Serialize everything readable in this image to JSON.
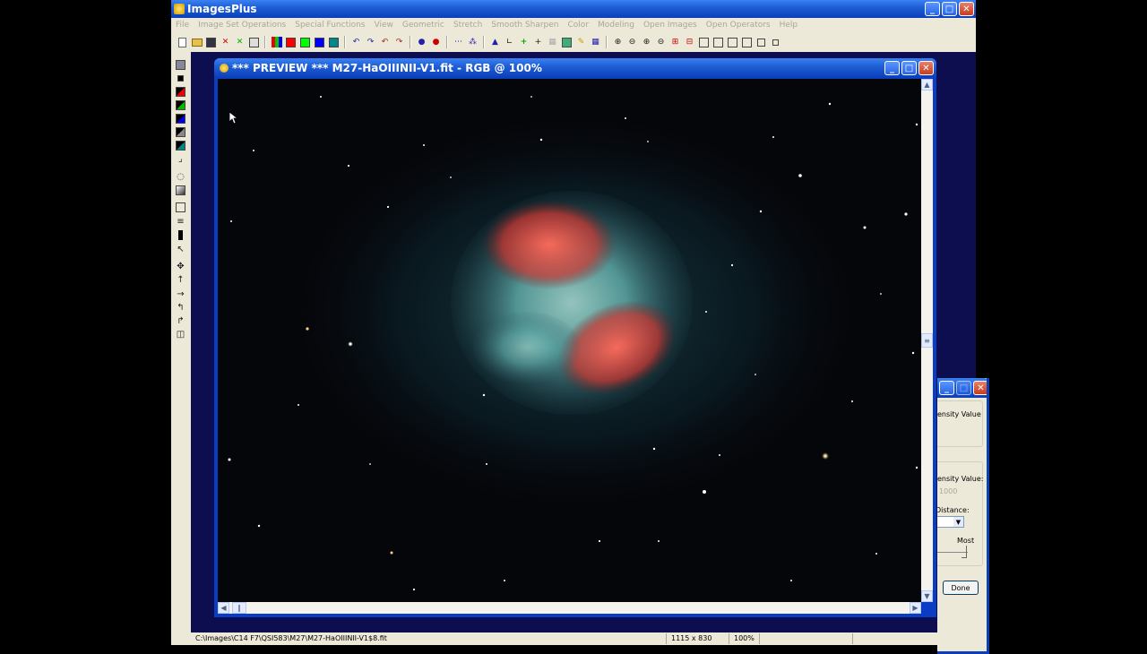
{
  "app": {
    "title": "ImagesPlus"
  },
  "menu": [
    "File",
    "Image Set Operations",
    "Special Functions",
    "View",
    "Geometric",
    "Stretch",
    "Smooth Sharpen",
    "Color",
    "Modeling",
    "Open Images",
    "Open Operators",
    "Help"
  ],
  "image_window": {
    "title": "*** PREVIEW *** M27-HaOIIINII-V1.fit - RGB @  100%"
  },
  "dialog": {
    "label1": "ensity Value",
    "label2": "ensity Value:",
    "value_placeholder": "1000",
    "label3": "Distance:",
    "label4": "Most",
    "done_label": "Done"
  },
  "status": {
    "path": "C:\\Images\\C14 F7\\QSI583\\M27\\M27-HaOIIINII-V1$8.fit",
    "dimensions": "1115 x 830",
    "zoom": "100%"
  },
  "colors": {
    "title_blue": "#0a3fb8",
    "mdi_background": "#0c0e50",
    "nebula_red": "#e0413b",
    "nebula_teal": "#4fa6a8"
  }
}
